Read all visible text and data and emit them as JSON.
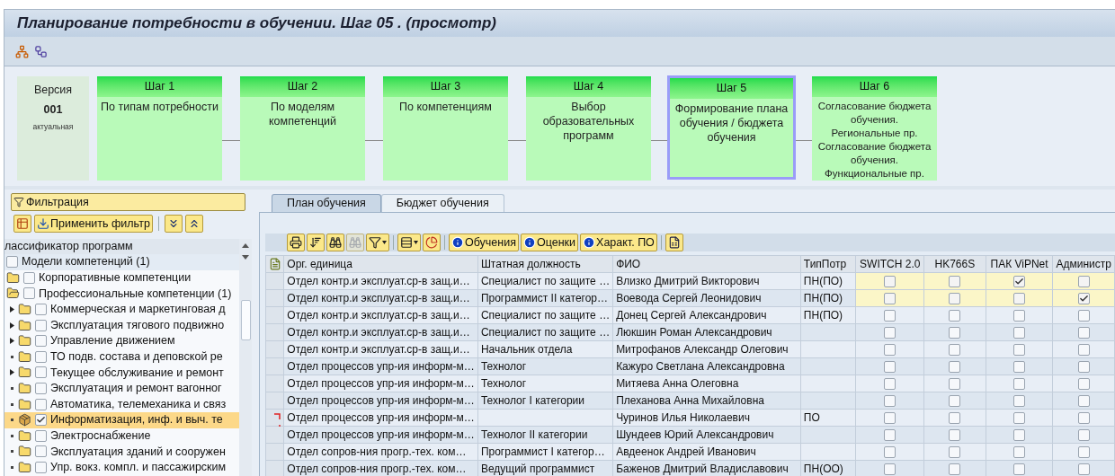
{
  "window": {
    "title": "Планирование потребности в обучении. Шаг 05 . (просмотр)"
  },
  "version": {
    "label": "Версия",
    "number": "001",
    "status": "актуальная"
  },
  "steps": [
    {
      "label": "Шаг 1",
      "items": [
        "По типам потребности"
      ],
      "selected": false
    },
    {
      "label": "Шаг 2",
      "items": [
        "По моделям компетенций"
      ],
      "selected": false
    },
    {
      "label": "Шаг 3",
      "items": [
        "По компетенциям"
      ],
      "selected": false
    },
    {
      "label": "Шаг 4",
      "items": [
        "Выбор образовательных программ"
      ],
      "selected": false
    },
    {
      "label": "Шаг 5",
      "items": [
        "Формирование плана обучения / бюджета обучения"
      ],
      "selected": true
    },
    {
      "label": "Шаг 6",
      "items": [
        "Согласование бюджета обучения. Региональные пр.",
        "Согласование бюджета обучения. Функциональные пр."
      ],
      "selected": false
    }
  ],
  "filter": {
    "title": "Фильтрация",
    "apply_button": "Применить фильтр"
  },
  "tree": {
    "header": "лассификатор программ",
    "items": [
      {
        "label": "Модели компетенций (1)",
        "kind": "plain",
        "checked": false,
        "selected": false,
        "children": [
          {
            "label": "Корпоративные компетенции",
            "kind": "folder",
            "checked": false,
            "selected": false,
            "expanded": false
          },
          {
            "label": "Профессиональные компетенции (1)",
            "kind": "folder",
            "checked": false,
            "selected": false,
            "expanded": true,
            "children": [
              {
                "label": "Коммерческая и маркетинговая д",
                "kind": "folder",
                "checked": false,
                "selected": false,
                "expandable": true
              },
              {
                "label": "Эксплуатация тягового подвижно",
                "kind": "folder",
                "checked": false,
                "selected": false,
                "expandable": true
              },
              {
                "label": "Управление движением",
                "kind": "folder",
                "checked": false,
                "selected": false,
                "expandable": true
              },
              {
                "label": "ТО подв. состава и деповской ре",
                "kind": "folder",
                "checked": false,
                "selected": false,
                "expandable": false
              },
              {
                "label": "Текущее обслуживание и ремонт",
                "kind": "folder",
                "checked": false,
                "selected": false,
                "expandable": true
              },
              {
                "label": "Эксплуатация и ремонт вагонног",
                "kind": "folder",
                "checked": false,
                "selected": false,
                "expandable": false
              },
              {
                "label": "Автоматика, телемеханика и связ",
                "kind": "folder",
                "checked": false,
                "selected": false,
                "expandable": false
              },
              {
                "label": "Информатизация, инф. и выч. те",
                "kind": "object",
                "checked": true,
                "selected": true,
                "expandable": false
              },
              {
                "label": "Электроснабжение",
                "kind": "folder",
                "checked": false,
                "selected": false,
                "expandable": false
              },
              {
                "label": "Эксплуатация зданий и сооружен",
                "kind": "folder",
                "checked": false,
                "selected": false,
                "expandable": false
              },
              {
                "label": "Упр. вокз. компл. и пассажирским",
                "kind": "folder",
                "checked": false,
                "selected": false,
                "expandable": false
              }
            ]
          }
        ]
      }
    ]
  },
  "tabs": [
    {
      "label": "План обучения",
      "selected": true
    },
    {
      "label": "Бюджет обучения",
      "selected": false
    }
  ],
  "info_buttons": [
    "Обучения",
    "Оценки",
    "Характ. ПО"
  ],
  "table": {
    "columns": [
      {
        "label": "Орг. единица",
        "kind": "text"
      },
      {
        "label": "Штатная должность",
        "kind": "text"
      },
      {
        "label": "ФИО",
        "kind": "text"
      },
      {
        "label": "ТипПотр",
        "kind": "text"
      },
      {
        "label": "SWITCH 2.0",
        "kind": "check"
      },
      {
        "label": "HK766S",
        "kind": "check"
      },
      {
        "label": "ПАК ViPNet",
        "kind": "check"
      },
      {
        "label": "Администр",
        "kind": "check"
      }
    ],
    "rows": [
      {
        "org": "Отдел контр.и эксплуат.ср-в защ.и…",
        "position": "Специалист по защите …",
        "name": "Влизко Дмитрий Викторович",
        "need_type": "ПН(ПО)",
        "checks": [
          false,
          false,
          true,
          false
        ],
        "highlighted": true,
        "marked": false
      },
      {
        "org": "Отдел контр.и эксплуат.ср-в защ.и…",
        "position": "Программист II категор…",
        "name": "Воевода Сергей Леонидович",
        "need_type": "ПН(ПО)",
        "checks": [
          false,
          false,
          false,
          true
        ],
        "highlighted": true,
        "marked": false
      },
      {
        "org": "Отдел контр.и эксплуат.ср-в защ.и…",
        "position": "Специалист по защите …",
        "name": "Донец Сергей Александрович",
        "need_type": "ПН(ПО)",
        "checks": [
          false,
          false,
          false,
          false
        ],
        "highlighted": false,
        "marked": false
      },
      {
        "org": "Отдел контр.и эксплуат.ср-в защ.и…",
        "position": "Специалист по защите …",
        "name": "Люкшин Роман Александрович",
        "checks": [
          false,
          false,
          false,
          false
        ],
        "highlighted": false,
        "marked": false
      },
      {
        "org": "Отдел контр.и эксплуат.ср-в защ.и…",
        "position": "Начальник отдела",
        "name": "Митрофанов Александр Олегович",
        "checks": [
          false,
          false,
          false,
          false
        ],
        "highlighted": false,
        "marked": false
      },
      {
        "org": "Отдел процессов упр-ия информ-м…",
        "position": "Технолог",
        "name": "Кажуро Светлана Александровна",
        "checks": [
          false,
          false,
          false,
          false
        ],
        "highlighted": false,
        "marked": false
      },
      {
        "org": "Отдел процессов упр-ия информ-м…",
        "position": "Технолог",
        "name": "Митяева Анна Олеговна",
        "checks": [
          false,
          false,
          false,
          false
        ],
        "highlighted": false,
        "marked": false
      },
      {
        "org": "Отдел процессов упр-ия информ-м…",
        "position": "Технолог I категории",
        "name": "Плеханова Анна Михайловна",
        "checks": [
          false,
          false,
          false,
          false
        ],
        "highlighted": false,
        "marked": false
      },
      {
        "org": "Отдел процессов упр-ия информ-м…",
        "name": "Чуринов Илья Николаевич",
        "need_type": "ПО",
        "checks": [
          false,
          false,
          false,
          false
        ],
        "highlighted": false,
        "marked": true
      },
      {
        "org": "Отдел процессов упр-ия информ-м…",
        "position": "Технолог II категории",
        "name": "Шундеев Юрий Александрович",
        "checks": [
          false,
          false,
          false,
          false
        ],
        "highlighted": false,
        "marked": false
      },
      {
        "org": "Отдел сопров-ния прогр.-тех. ком…",
        "position": "Программист I категор…",
        "name": "Авдеенок Андрей Иванович",
        "checks": [
          false,
          false,
          false,
          false
        ],
        "highlighted": false,
        "marked": false
      },
      {
        "org": "Отдел сопров-ния прогр.-тех. ком…",
        "position": "Ведущий программист",
        "name": "Баженов Дмитрий Владиславович",
        "need_type": "ПН(ОО)",
        "checks": [
          false,
          false,
          false,
          false
        ],
        "highlighted": false,
        "marked": false
      }
    ]
  }
}
